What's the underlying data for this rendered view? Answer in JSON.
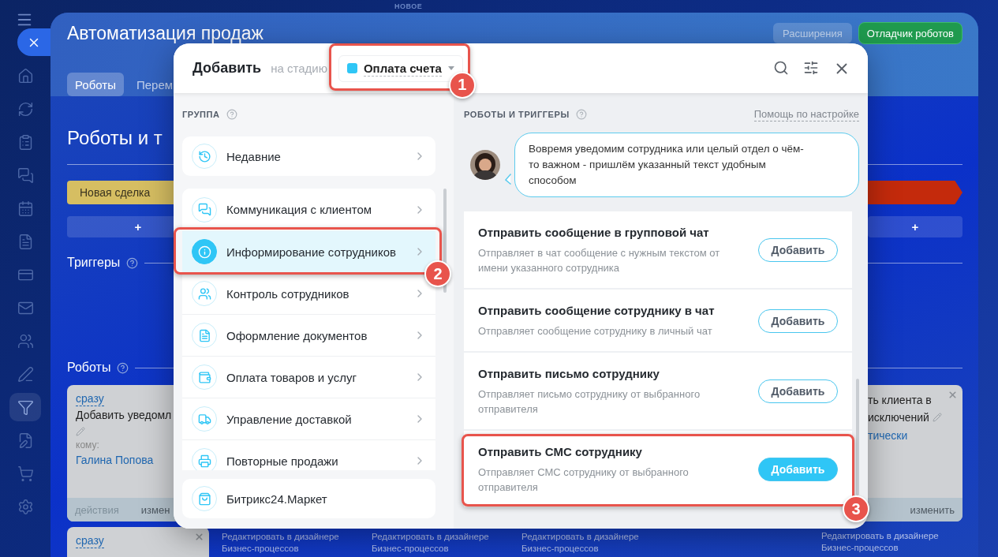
{
  "sidebar": {
    "items": [
      {
        "selected": false
      },
      {
        "selected": false
      },
      {
        "selected": false
      },
      {
        "selected": false
      },
      {
        "selected": false
      },
      {
        "selected": false
      },
      {
        "selected": false
      },
      {
        "selected": false
      },
      {
        "selected": false
      },
      {
        "selected": false
      },
      {
        "selected": true
      },
      {
        "selected": false
      },
      {
        "selected": false
      },
      {
        "selected": false
      }
    ]
  },
  "top_label": "НОВОЕ",
  "page": {
    "title": "Автоматизация продаж",
    "extensions_button": "Расширения",
    "debugger_button": "Отладчик роботов",
    "tabs": [
      {
        "label": "Роботы",
        "selected": true
      },
      {
        "label": "Перем",
        "selected": false
      }
    ],
    "heading": "Роботы и т"
  },
  "stages": [
    {
      "label": "Новая сделка",
      "color": "#d6be62"
    },
    {
      "color": "#c42a0c"
    }
  ],
  "add_buttons": [
    "+",
    "+"
  ],
  "triggers_label": "Триггеры",
  "robots_label": "Роботы",
  "robot_columns": [
    {
      "cards": [
        {
          "timing": "сразу",
          "title_lines": [
            "Добавить уведомл"
          ],
          "editable": true,
          "recipient_label": "кому:",
          "recipient": "Галина Попова",
          "footer_left": "действия",
          "footer_right": "измен"
        },
        {
          "timing": "сразу",
          "closable": true
        }
      ]
    },
    {
      "link": "Редактировать в дизайнере Бизнес-процессов"
    },
    {
      "link": "Редактировать в дизайнере Бизнес-процессов"
    },
    {
      "link": "Редактировать в дизайнере Бизнес-процессов"
    }
  ],
  "right_column": {
    "card": {
      "title_lines": [
        "ть клиента в",
        "исключений"
      ],
      "editable": true,
      "recipient": "тически",
      "footer_right": "изменить",
      "closable": true
    },
    "link": "Редактировать в дизайнере Бизнес-процессов"
  },
  "dialog": {
    "title": "Добавить",
    "stage_prefix": "на стадию",
    "stage": {
      "label": "Оплата счета",
      "color": "#2fc6f6",
      "callout": "1"
    },
    "group_heading": "ГРУППА",
    "recent": {
      "label": "Недавние"
    },
    "groups": [
      {
        "label": "Коммуникация с клиентом",
        "selected": false
      },
      {
        "label": "Информирование сотрудников",
        "selected": true,
        "callout": "2"
      },
      {
        "label": "Контроль сотрудников",
        "selected": false
      },
      {
        "label": "Оформление документов",
        "selected": false
      },
      {
        "label": "Оплата товаров и услуг",
        "selected": false
      },
      {
        "label": "Управление доставкой",
        "selected": false
      },
      {
        "label": "Повторные продажи",
        "selected": false
      }
    ],
    "market": {
      "label": "Битрикс24.Маркет"
    },
    "robots_heading": "РОБОТЫ И ТРИГГЕРЫ",
    "help_link": "Помощь по настройке",
    "hint": "Вовремя уведомим сотрудника или целый отдел о чём-то важном - пришлём указанный текст удобным способом",
    "robots": [
      {
        "title": "Отправить сообщение в групповой чат",
        "description": "Отправляет в чат сообщение с нужным текстом от имени указанного сотрудника",
        "button": "Добавить",
        "selected": false
      },
      {
        "title": "Отправить сообщение сотруднику в чат",
        "description": "Отправляет сообщение сотруднику в личный чат",
        "button": "Добавить",
        "selected": false
      },
      {
        "title": "Отправить письмо сотруднику",
        "description": "Отправляет письмо сотруднику от выбранного отправителя",
        "button": "Добавить",
        "selected": false
      },
      {
        "title": "Отправить СМС сотруднику",
        "description": "Отправляет СМС сотруднику от выбранного отправителя",
        "button": "Добавить",
        "selected": true,
        "callout": "3"
      }
    ]
  }
}
